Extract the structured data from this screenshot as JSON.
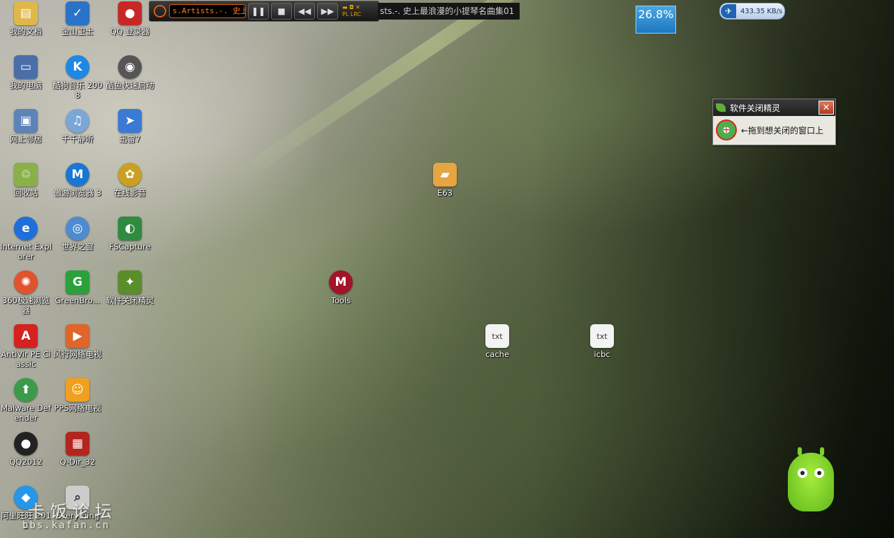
{
  "desktop_icons": [
    {
      "label": "我的文档",
      "glyph": "▤",
      "color": "#e0b84a"
    },
    {
      "label": "金山卫士",
      "glyph": "✓",
      "color": "#2a73c9"
    },
    {
      "label": "QQ 登录器",
      "glyph": "●",
      "color": "#c62828"
    },
    {
      "label": "我的电脑",
      "glyph": "▭",
      "color": "#4a6ea8"
    },
    {
      "label": "酷狗音乐 2008",
      "glyph": "K",
      "color": "#1e88e5"
    },
    {
      "label": "酷鱼快速启动",
      "glyph": "◉",
      "color": "#555555"
    },
    {
      "label": "网上邻居",
      "glyph": "▣",
      "color": "#5c84b8"
    },
    {
      "label": "千千静听",
      "glyph": "♫",
      "color": "#7ba7d8"
    },
    {
      "label": "迅雷7",
      "glyph": "➤",
      "color": "#3a7ad4"
    },
    {
      "label": "回收站",
      "glyph": "♲",
      "color": "#8ab04a"
    },
    {
      "label": "傲游浏览器 3",
      "glyph": "M",
      "color": "#1976d2"
    },
    {
      "label": "在线影音",
      "glyph": "✿",
      "color": "#c9a022"
    },
    {
      "label": "Internet Explorer",
      "glyph": "e",
      "color": "#1e6fd9"
    },
    {
      "label": "世界之窗",
      "glyph": "◎",
      "color": "#4f8ccf"
    },
    {
      "label": "FSCapture",
      "glyph": "◐",
      "color": "#2e8b3f"
    },
    {
      "label": "360极速浏览器",
      "glyph": "✺",
      "color": "#e0532c"
    },
    {
      "label": "GreenBro...",
      "glyph": "G",
      "color": "#2aa13b"
    },
    {
      "label": "软件关闭精灵",
      "glyph": "✦",
      "color": "#5a8e2a"
    },
    {
      "label": "AntiVir PE Classic",
      "glyph": "A",
      "color": "#d62121"
    },
    {
      "label": "风行网络电视",
      "glyph": "▶",
      "color": "#e0652a"
    },
    {
      "label": "Malware Defender",
      "glyph": "⬆",
      "color": "#3b9b4a"
    },
    {
      "label": "PPS网络电视",
      "glyph": "☺",
      "color": "#f0a020"
    },
    {
      "label": "QQ2012",
      "glyph": "●",
      "color": "#222222"
    },
    {
      "label": "Q-Dir_32",
      "glyph": "▦",
      "color": "#b2261f"
    },
    {
      "label": "阿里旺旺 2012",
      "glyph": "◆",
      "color": "#2596e8"
    },
    {
      "label": "Everything",
      "glyph": "⌕",
      "color": "#cccccc"
    },
    {
      "label": "E63",
      "glyph": "▰",
      "color": "#e6a540"
    },
    {
      "label": "Tools",
      "glyph": "M",
      "color": "#a3132a"
    },
    {
      "label": "cache",
      "glyph": "txt",
      "color": "#f3f3f3"
    },
    {
      "label": "icbc",
      "glyph": "txt",
      "color": "#f3f3f3"
    }
  ],
  "player": {
    "song": "s.Artists.-. 史上",
    "pause": "❚❚",
    "stop": "■",
    "prev": "◀◀",
    "next": "▶▶",
    "pl": "PL",
    "lrc": "LRC"
  },
  "ticker": "sts.-. 史上最浪漫的小提琴名曲集01",
  "cpu": "26.8%",
  "network": "433.35 KB/s",
  "killer": {
    "title": "软件关闭精灵",
    "close": "✕",
    "hint": "←拖到想关闭的窗口上"
  },
  "watermark": "卡饭论坛",
  "watermark_url": "bbs.kafan.cn"
}
